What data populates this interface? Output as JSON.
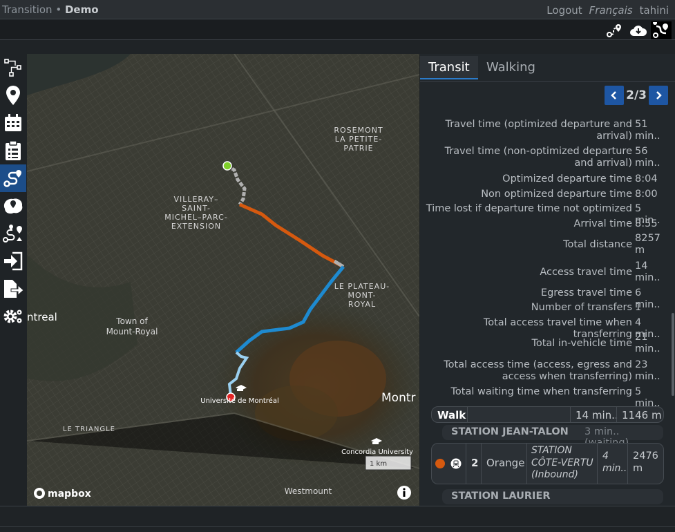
{
  "app": {
    "title": "Transition",
    "separator": "•",
    "project": "Demo"
  },
  "user_menu": {
    "logout": "Logout",
    "language": "Français",
    "username": "tahini"
  },
  "toolbar_icons": [
    "route-pin-icon",
    "cloud-download-icon",
    "routing-icon"
  ],
  "sidebar_icons": [
    "nodes-icon",
    "map-pin-icon",
    "calendar-icon",
    "clipboard-icon",
    "routing-icon",
    "accessibility-map-icon",
    "batch-routing-icon",
    "import-icon",
    "export-icon",
    "settings-icon"
  ],
  "map": {
    "labels": {
      "rosemont": [
        "ROSEMONT",
        "LA PETITE-",
        "PATRIE"
      ],
      "villeray": [
        "VILLERAY–",
        "SAINT-",
        "MICHEL–PARC-",
        "EXTENSION"
      ],
      "plateau": [
        "LE PLATEAU-",
        "MONT-",
        "ROYAL"
      ],
      "town": [
        "Town of",
        "Mount-Royal"
      ],
      "outremont": "ntreal",
      "montreal": "Montr",
      "udem": "Université de Montréal",
      "triangle": "LE TRIANGLE",
      "concordia": "Concordia University",
      "westmount": "Westmount",
      "scale": "1 km",
      "mapbox": "mapbox"
    },
    "colors": {
      "walk": "#9a9a9a",
      "orange_line": "#d5590f",
      "blue_line": "#1e8ad0",
      "origin": "#7fcf2a",
      "destination": "#e12424"
    }
  },
  "panel": {
    "tabs": {
      "transit": "Transit",
      "walking": "Walking"
    },
    "pager": {
      "count": "2/3"
    },
    "stats": [
      {
        "label": "Travel time (optimized departure and arrival)",
        "value": "51 min.."
      },
      {
        "label": "Travel time (non-optimized departure and arrival)",
        "value": "56 min.."
      },
      {
        "label": "Optimized departure time",
        "value": "8:04"
      },
      {
        "label": "Non optimized departure time",
        "value": "8:00"
      },
      {
        "label": "Time lost if departure time not optimized",
        "value": "5 min.."
      },
      {
        "label": "Arrival time",
        "value": "8:55"
      },
      {
        "label": "Total distance",
        "value": "8257 m"
      },
      {
        "label": "Access travel time",
        "value": "14 min.."
      },
      {
        "label": "Egress travel time",
        "value": "6 min.."
      },
      {
        "label": "Number of transfers",
        "value": "1"
      },
      {
        "label": "Total access travel time when transferring",
        "value": "4 min.."
      },
      {
        "label": "Total in-vehicle time",
        "value": "21 min.."
      },
      {
        "label": "Total access time (access, egress and access when transferring)",
        "value": "23 min.."
      },
      {
        "label": "Total waiting time when transferring",
        "value": "5 min.."
      }
    ],
    "steps": {
      "walk": {
        "mode": "Walk",
        "time": "14 min..",
        "distance": "1146 m"
      },
      "station1": {
        "name": "STATION JEAN-TALON",
        "wait": "3 min.. (waiting)"
      },
      "ride": {
        "line_number": "2",
        "line_name": "Orange",
        "destination": "STATION CÔTE-VERTU (Inbound)",
        "time": "4 min..",
        "distance": "2476 m",
        "line_color": "#d5590f"
      },
      "station2": {
        "name": "STATION LAURIER"
      }
    }
  }
}
